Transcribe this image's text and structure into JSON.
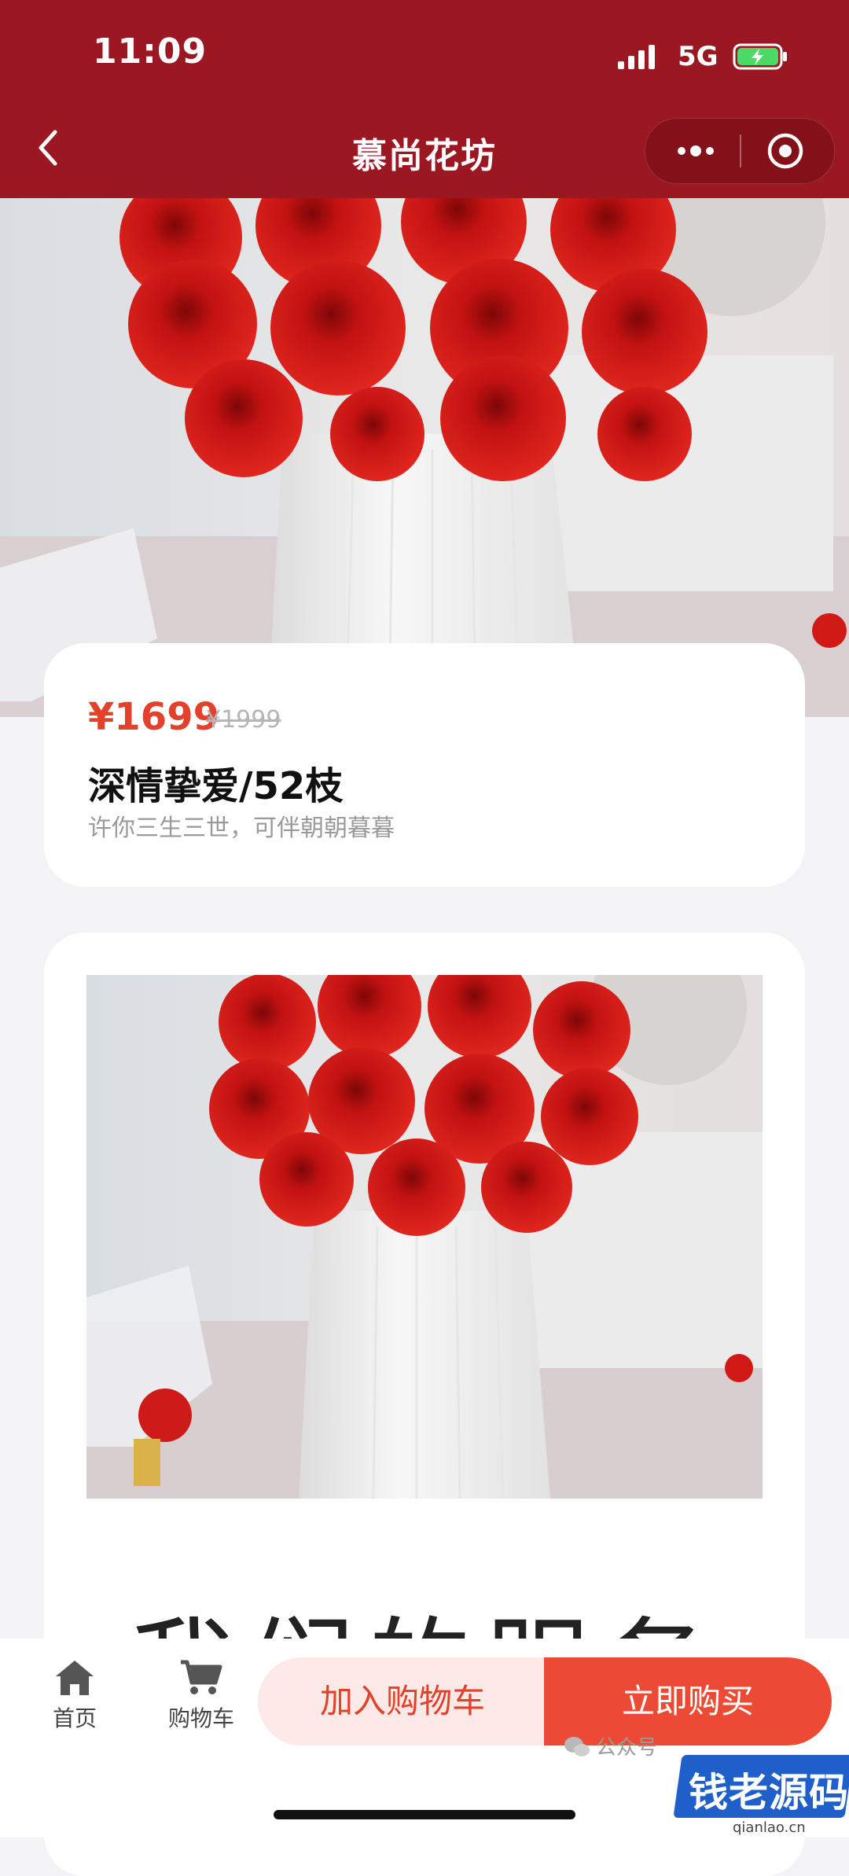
{
  "status_bar": {
    "time": "11:09",
    "network": "5G"
  },
  "nav": {
    "title": "慕尚花坊"
  },
  "product": {
    "price": "¥1699",
    "original_price": "¥1999",
    "name": "深情挚爱/52枝",
    "slogan": "许你三生三世，可伴朝朝暮暮"
  },
  "detail": {
    "services_heading": "我们的服务"
  },
  "tabbar": {
    "home_label": "首页",
    "cart_label": "购物车",
    "add_to_cart": "加入购物车",
    "buy_now": "立即购买"
  },
  "overlay": {
    "wechat_label": "公众号",
    "watermark_text": "钱老源码",
    "watermark_domain": "qianlao.cn"
  },
  "colors": {
    "header_bg": "#9b1722",
    "accent": "#ec4a35",
    "price": "#e2412b",
    "add_cart_bg": "#fdeae7"
  },
  "icons": [
    "signal-icon",
    "battery-charging-icon",
    "back-chevron-icon",
    "more-dots-icon",
    "close-circle-icon",
    "home-icon",
    "cart-icon",
    "wechat-icon"
  ]
}
